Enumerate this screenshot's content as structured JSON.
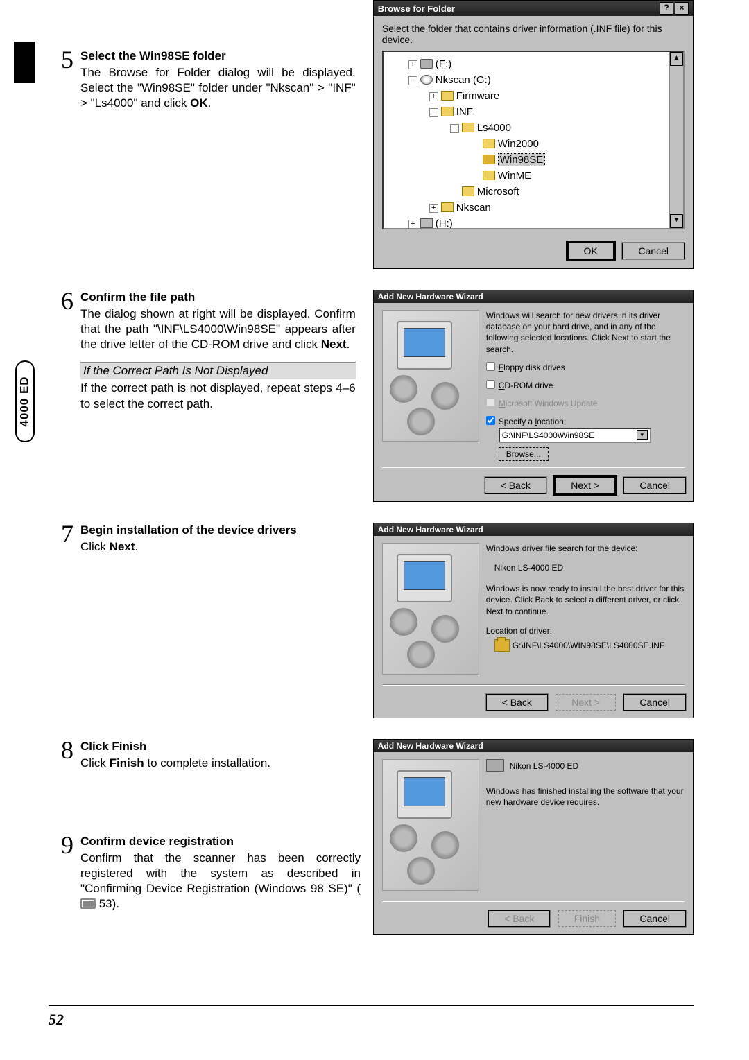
{
  "side_tab": "4000 ED",
  "page_number": "52",
  "step5": {
    "num": "5",
    "title": "Select the Win98SE folder",
    "body": "The Browse for Folder dialog will be displayed.  Select the \"Win98SE\" folder under \"Nkscan\" > \"INF\" > \"Ls4000\" and click ",
    "bold": "OK",
    "tail": "."
  },
  "step6": {
    "num": "6",
    "title": "Confirm the file path",
    "body1": "The dialog shown at right will be displayed.  Confirm that the path \"\\INF\\LS4000\\Win98SE\" appears after the drive letter of the CD-ROM drive and click ",
    "bold1": "Next",
    "tail1": ".",
    "subhead": "If the Correct Path Is Not Displayed",
    "body2": "If the correct path is not displayed, repeat steps 4–6 to select the correct path."
  },
  "step7": {
    "num": "7",
    "title": "Begin installation of the device drivers",
    "body": "Click ",
    "bold": "Next",
    "tail": "."
  },
  "step8": {
    "num": "8",
    "title_pre": "Click ",
    "title_bold": "Finish",
    "body": "Click ",
    "bold": "Finish",
    "tail": " to complete installation."
  },
  "step9": {
    "num": "9",
    "title": "Confirm device registration",
    "body": "Confirm that the scanner has been correctly registered with the system as described in \"Confirming Device Registration (Windows 98 SE)\" (",
    "pgref": " 53)."
  },
  "browse": {
    "title": "Browse for Folder",
    "help_btn": "?",
    "close_btn": "×",
    "hint": "Select the folder that contains driver information (.INF file) for this device.",
    "tree": {
      "f": "(F:)",
      "g": "Nkscan (G:)",
      "firmware": "Firmware",
      "inf": "INF",
      "ls4000": "Ls4000",
      "win2000": "Win2000",
      "win98se": "Win98SE",
      "winme": "WinME",
      "microsoft": "Microsoft",
      "nkscan2": "Nkscan",
      "h": "(H:)"
    },
    "ok": "OK",
    "cancel": "Cancel"
  },
  "wiz1": {
    "title": "Add New Hardware Wizard",
    "intro": "Windows will search for new drivers in its driver database on your hard drive, and in any of the following selected locations. Click Next to start the search.",
    "floppy_u": "F",
    "floppy": "loppy disk drives",
    "cd_u": "C",
    "cd": "D-ROM drive",
    "update_u": "M",
    "update": "icrosoft Windows Update",
    "spec": "Specify a ",
    "spec_u": "l",
    "spec2": "ocation:",
    "path": "G:\\INF\\LS4000\\Win98SE",
    "browse_u": "B",
    "browse": "rowse...",
    "back": "< Back",
    "back_u": "B",
    "next": "Next >",
    "next_u": "N",
    "cancel": "Cancel"
  },
  "wiz2": {
    "title": "Add New Hardware Wizard",
    "line1": "Windows driver file search for the device:",
    "device": "Nikon LS-4000 ED",
    "line2": "Windows is now ready to install the best driver for this device. Click Back to select a different driver, or click Next to continue.",
    "loc_label": "Location of driver:",
    "loc_path": "G:\\INF\\LS4000\\WIN98SE\\LS4000SE.INF",
    "back": "< Back",
    "next": "Next >",
    "cancel": "Cancel"
  },
  "wiz3": {
    "title": "Add New Hardware Wizard",
    "device": "Nikon LS-4000 ED",
    "msg": "Windows has finished installing the software that your new hardware device requires.",
    "back": "< Back",
    "finish": "Finish",
    "cancel": "Cancel"
  }
}
